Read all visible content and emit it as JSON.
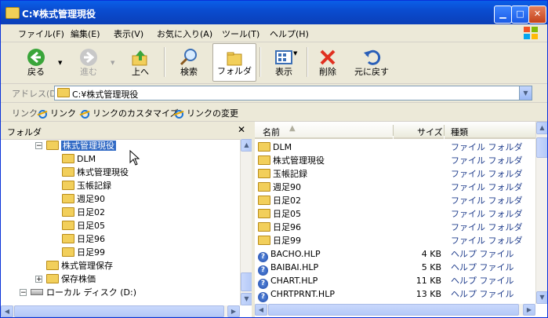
{
  "window": {
    "title": "C:¥株式管理現役"
  },
  "menu": [
    "ファイル(F)",
    "編集(E)",
    "表示(V)",
    "お気に入り(A)",
    "ツール(T)",
    "ヘルプ(H)"
  ],
  "toolbar": {
    "back": "戻る",
    "forward": "進む",
    "up": "上へ",
    "search": "検索",
    "folders": "フォルダ",
    "views": "表示",
    "delete": "削除",
    "undo": "元に戻す"
  },
  "address": {
    "label": "アドレス(D)",
    "value": "C:¥株式管理現役"
  },
  "links": {
    "label": "リンク",
    "items": [
      "リンク",
      "リンクのカスタマイズ",
      "リンクの変更"
    ]
  },
  "folder_pane": {
    "title": "フォルダ",
    "tree": [
      {
        "label": "株式管理現役",
        "level": 0,
        "toggle": "−",
        "selected": true
      },
      {
        "label": "DLM",
        "level": 1
      },
      {
        "label": "株式管理現役",
        "level": 1
      },
      {
        "label": "玉帳記録",
        "level": 1
      },
      {
        "label": "週足90",
        "level": 1
      },
      {
        "label": "日足02",
        "level": 1
      },
      {
        "label": "日足05",
        "level": 1
      },
      {
        "label": "日足96",
        "level": 1
      },
      {
        "label": "日足99",
        "level": 1
      },
      {
        "label": "株式管理保存",
        "level": 0
      },
      {
        "label": "保存株価",
        "level": 0,
        "toggle": "+"
      },
      {
        "label": "ローカル ディスク (D:)",
        "level": -1,
        "toggle": "−",
        "drive": true
      }
    ]
  },
  "list_pane": {
    "columns": {
      "name": "名前",
      "size": "サイズ",
      "type": "種類"
    },
    "rows": [
      {
        "name": "DLM",
        "size": "",
        "type": "ファイル フォルダ",
        "icon": "folder"
      },
      {
        "name": "株式管理現役",
        "size": "",
        "type": "ファイル フォルダ",
        "icon": "folder"
      },
      {
        "name": "玉帳記録",
        "size": "",
        "type": "ファイル フォルダ",
        "icon": "folder"
      },
      {
        "name": "週足90",
        "size": "",
        "type": "ファイル フォルダ",
        "icon": "folder"
      },
      {
        "name": "日足02",
        "size": "",
        "type": "ファイル フォルダ",
        "icon": "folder"
      },
      {
        "name": "日足05",
        "size": "",
        "type": "ファイル フォルダ",
        "icon": "folder"
      },
      {
        "name": "日足96",
        "size": "",
        "type": "ファイル フォルダ",
        "icon": "folder"
      },
      {
        "name": "日足99",
        "size": "",
        "type": "ファイル フォルダ",
        "icon": "folder"
      },
      {
        "name": "BACHO.HLP",
        "size": "4 KB",
        "type": "ヘルプ ファイル",
        "icon": "help"
      },
      {
        "name": "BAIBAI.HLP",
        "size": "5 KB",
        "type": "ヘルプ ファイル",
        "icon": "help"
      },
      {
        "name": "CHART.HLP",
        "size": "11 KB",
        "type": "ヘルプ ファイル",
        "icon": "help"
      },
      {
        "name": "CHRTPRNT.HLP",
        "size": "13 KB",
        "type": "ヘルプ ファイル",
        "icon": "help"
      }
    ]
  },
  "colors": {
    "titlebar": "#0a4cd0",
    "selection": "#316ac5",
    "type_text": "#1e3c8c",
    "folder": "#f2cf5b"
  }
}
